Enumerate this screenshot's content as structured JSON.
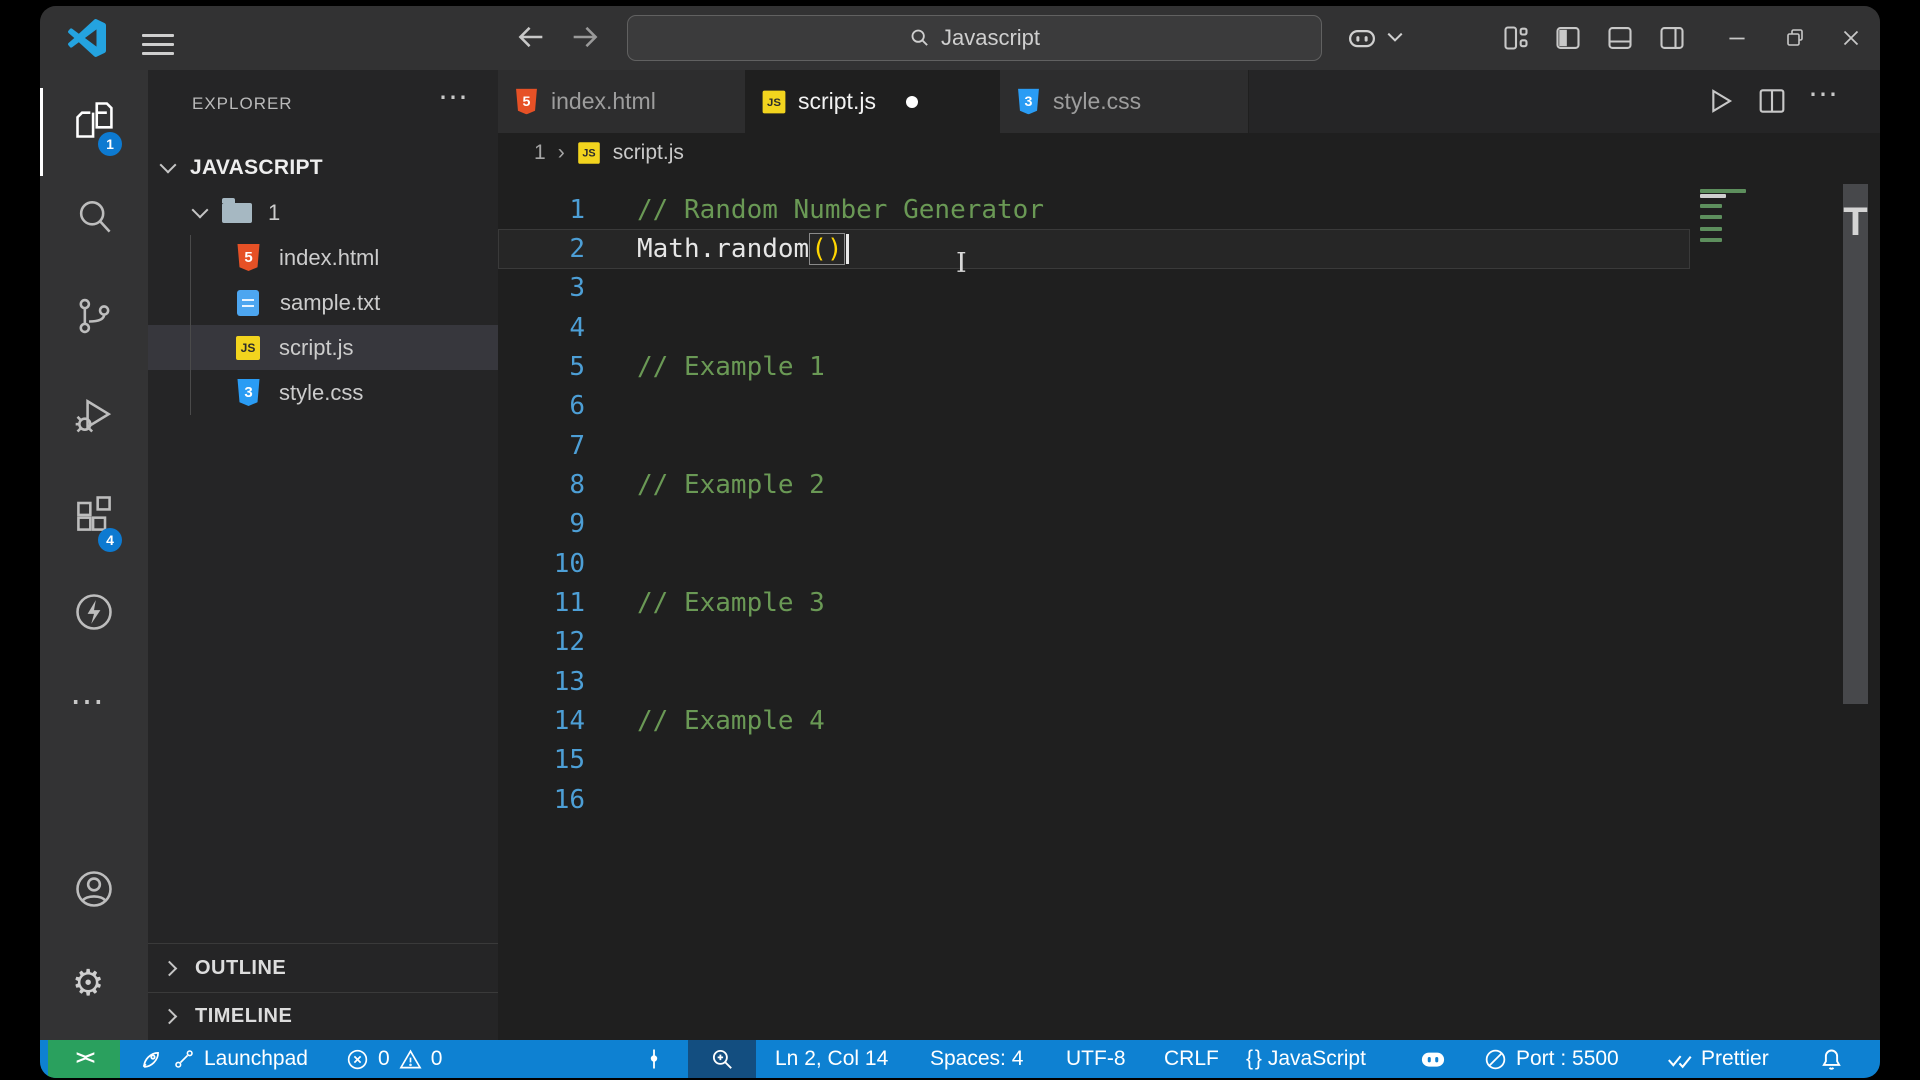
{
  "title_bar": {
    "search_text": "Javascript"
  },
  "activity_bar": {
    "explorer_badge": "1",
    "extensions_badge": "4"
  },
  "sidebar": {
    "title": "EXPLORER",
    "more_actions": "⋯",
    "workspace": "JAVASCRIPT",
    "folder": "1",
    "files": [
      {
        "name": "index.html",
        "type": "html"
      },
      {
        "name": "sample.txt",
        "type": "txt"
      },
      {
        "name": "script.js",
        "type": "js",
        "selected": true
      },
      {
        "name": "style.css",
        "type": "css"
      }
    ],
    "outline_label": "OUTLINE",
    "timeline_label": "TIMELINE"
  },
  "tabs": [
    {
      "label": "index.html",
      "active": false,
      "modified": false
    },
    {
      "label": "script.js",
      "active": true,
      "modified": true
    },
    {
      "label": "style.css",
      "active": false,
      "modified": false
    }
  ],
  "editor_actions": {
    "more": "⋯"
  },
  "breadcrumb": {
    "folder": "1",
    "separator": "›",
    "file": "script.js"
  },
  "editor": {
    "file_icon_text": "JS",
    "line2": {
      "code": "Math.random",
      "paren": "()"
    },
    "lines": [
      {
        "n": "1",
        "text": "// Random Number Generator"
      },
      {
        "n": "2",
        "text": "Math.random()"
      },
      {
        "n": "3",
        "text": ""
      },
      {
        "n": "4",
        "text": ""
      },
      {
        "n": "5",
        "text": "// Example 1"
      },
      {
        "n": "6",
        "text": ""
      },
      {
        "n": "7",
        "text": ""
      },
      {
        "n": "8",
        "text": "// Example 2"
      },
      {
        "n": "9",
        "text": ""
      },
      {
        "n": "10",
        "text": ""
      },
      {
        "n": "11",
        "text": "// Example 3"
      },
      {
        "n": "12",
        "text": ""
      },
      {
        "n": "13",
        "text": ""
      },
      {
        "n": "14",
        "text": "// Example 4"
      },
      {
        "n": "15",
        "text": ""
      },
      {
        "n": "16",
        "text": ""
      }
    ],
    "scrollbar_mark": "T"
  },
  "file_icons": {
    "html_glyph": "5",
    "css_glyph": "3",
    "js_glyph": "JS"
  },
  "status_bar": {
    "remote_glyph": "><",
    "launchpad": "Launchpad",
    "errors": "0",
    "warnings": "0",
    "cursor_position": "Ln 2, Col 14",
    "indentation": "Spaces: 4",
    "encoding": "UTF-8",
    "eol": "CRLF",
    "language_glyph": "{ }",
    "language": "JavaScript",
    "port": "Port : 5500",
    "formatter": "Prettier"
  },
  "colors": {
    "status_blue": "#0e81d2",
    "remote_green": "#2aa05e",
    "badge_blue": "#0d7ad1",
    "comment_green": "#6a9955",
    "bracket_gold": "#ffd602",
    "line_number_blue": "#4d9fd6",
    "editor_bg": "#1f1f1f",
    "sidebar_bg": "#252526",
    "titlebar_bg": "#323233",
    "js_icon_yellow": "#f2d41e",
    "html_icon_orange": "#e65126",
    "css_icon_blue": "#2a9cf4"
  }
}
